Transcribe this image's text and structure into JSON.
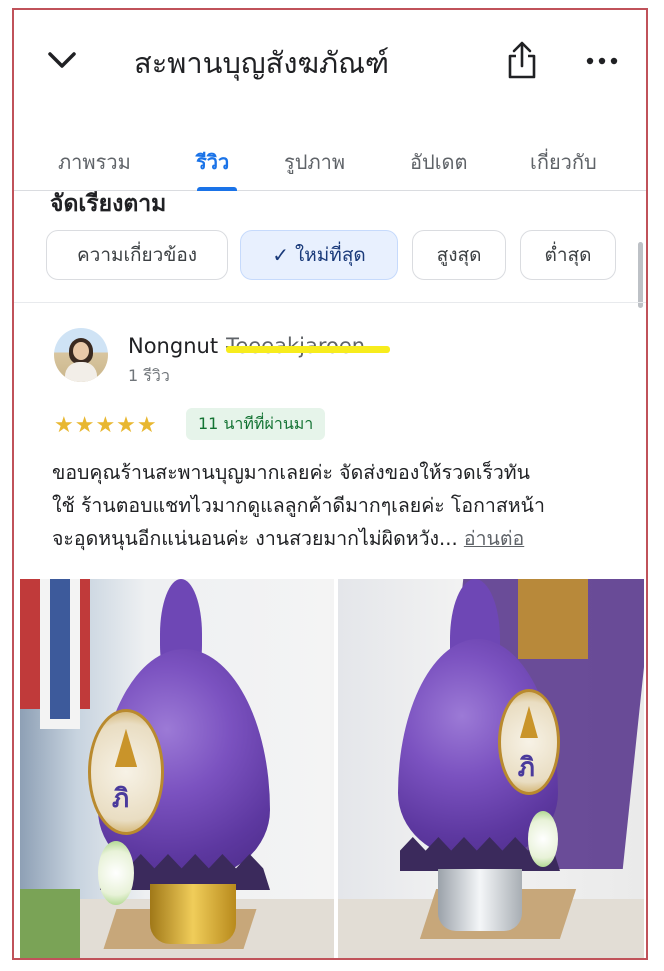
{
  "header": {
    "title": "สะพานบุญสังฆภัณฑ์",
    "back_icon": "chevron-down-icon",
    "share_icon": "share-icon",
    "more_icon": "more-horizontal-icon"
  },
  "tabs": [
    {
      "label": "ภาพรวม",
      "active": false
    },
    {
      "label": "รีวิว",
      "active": true
    },
    {
      "label": "รูปภาพ",
      "active": false
    },
    {
      "label": "อัปเดต",
      "active": false
    },
    {
      "label": "เกี่ยวกับ",
      "active": false
    }
  ],
  "sort": {
    "label": "จัดเรียงตาม",
    "chips": [
      {
        "label": "ความเกี่ยวข้อง",
        "selected": false
      },
      {
        "label": "ใหม่ที่สุด",
        "selected": true
      },
      {
        "label": "สูงสุด",
        "selected": false
      },
      {
        "label": "ต่ำสุด",
        "selected": false
      }
    ]
  },
  "review": {
    "first_name": "Nongnut",
    "last_name": "Teeeakjaroen",
    "review_count": "1 รีวิว",
    "stars": "★★★★★",
    "rating": 5,
    "time_ago": "11 นาทีที่ผ่านมา",
    "text_lines": [
      "ขอบคุณร้านสะพานบุญมากเลยค่ะ จัดส่งของให้รวดเร็วทัน",
      "ใช้ ร้านตอบแชทไวมากดูแลลูกค้าดีมากๆเลยค่ะ โอกาสหน้า",
      "จะอุดหนุนอีกแน่นอนค่ะ งานสวยมากไม่ผิดหวัง..."
    ],
    "more_label": "อ่านต่อ"
  },
  "colors": {
    "accent": "#1a73e8",
    "star": "#e8b730",
    "badge_bg": "#e6f4ea",
    "badge_text": "#137333",
    "frame_border": "#c0525a"
  }
}
